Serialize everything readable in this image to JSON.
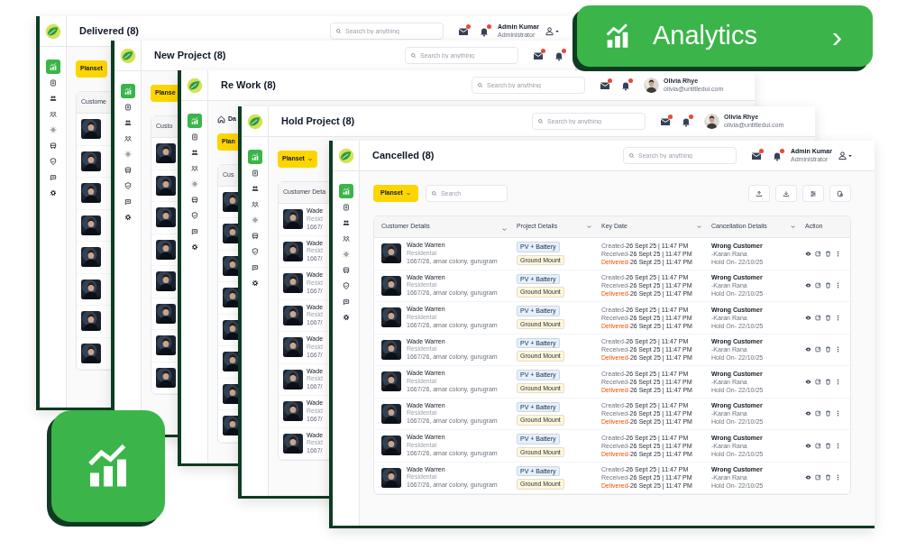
{
  "windows": [
    {
      "title": "Delivered (8)",
      "search": {
        "placeholder": "Search by anything"
      },
      "user": {
        "kind": "admin",
        "name": "Admin Kumar",
        "role": "Administrator"
      },
      "nav": [
        {
          "selected": true
        },
        {
          "selected": false
        },
        {
          "selected": false
        },
        {
          "selected": false
        },
        {
          "selected": false
        },
        {
          "selected": false
        },
        {
          "selected": false
        },
        {
          "selected": false
        },
        {
          "selected": false
        }
      ],
      "filter_button": {
        "label": "Planset",
        "caret": false
      },
      "table": {
        "header": "Custome"
      }
    },
    {
      "title": "New Project (8)",
      "search": {
        "placeholder": "Search by anything"
      },
      "nav": [
        {
          "selected": true
        },
        {
          "selected": false
        },
        {
          "selected": false
        },
        {
          "selected": false
        },
        {
          "selected": false
        },
        {
          "selected": false
        },
        {
          "selected": false
        },
        {
          "selected": false
        },
        {
          "selected": false
        }
      ],
      "filter_button": {
        "label": "Planse",
        "caret": false
      },
      "table": {
        "header": "Custo"
      }
    },
    {
      "title": "Re Work (8)",
      "search": {
        "placeholder": "Search by anything"
      },
      "user": {
        "kind": "avatar",
        "name": "Olivia Rhye",
        "email": "olivia@untitledui.com"
      },
      "nav": [
        {
          "selected": true
        },
        {
          "selected": false
        },
        {
          "selected": false
        },
        {
          "selected": false
        },
        {
          "selected": false
        },
        {
          "selected": false
        },
        {
          "selected": false
        },
        {
          "selected": false
        },
        {
          "selected": false
        }
      ],
      "breadcrumb": "Da",
      "filter_button": {
        "label": "Plan",
        "caret": false
      },
      "table": {
        "header": "Cus"
      }
    },
    {
      "title": "Hold Project (8)",
      "search": {
        "placeholder": "Search by anything"
      },
      "user": {
        "kind": "avatar",
        "name": "Olivia Rhye",
        "email": "olivia@untitledui.com"
      },
      "nav": [
        {
          "selected": true
        },
        {
          "selected": false
        },
        {
          "selected": false
        },
        {
          "selected": false
        },
        {
          "selected": false
        },
        {
          "selected": false
        },
        {
          "selected": false
        },
        {
          "selected": false
        },
        {
          "selected": false
        }
      ],
      "filter_button": {
        "label": "Planset",
        "caret": true
      },
      "table": {
        "header": "Customer Deta",
        "rows": [
          {
            "kind": "picture",
            "name": "Wade",
            "type": "Resid",
            "address": "1667/"
          },
          {
            "kind": "picture",
            "name": "Wade",
            "type": "Resid",
            "address": "1667/"
          },
          {
            "kind": "picture",
            "name": "Wade",
            "type": "Resid",
            "address": "1667/"
          },
          {
            "kind": "picture",
            "name": "Wade",
            "type": "Resid",
            "address": "1667/"
          },
          {
            "kind": "picture",
            "name": "Wade",
            "type": "Resid",
            "address": "1667/"
          },
          {
            "kind": "picture",
            "name": "Wade",
            "type": "Resid",
            "address": "1667/"
          },
          {
            "kind": "picture",
            "name": "Wade",
            "type": "Resid",
            "address": "1667/"
          },
          {
            "kind": "picture",
            "name": "Wade",
            "type": "Resid",
            "address": "1667/"
          }
        ]
      }
    },
    {
      "title": "Cancelled (8)",
      "search": {
        "placeholder": "Search by anything"
      },
      "user": {
        "kind": "admin",
        "name": "Admin Kumar",
        "role": "Administrator"
      },
      "nav": [
        {
          "selected": true
        },
        {
          "selected": false
        },
        {
          "selected": false
        },
        {
          "selected": false
        },
        {
          "selected": false
        },
        {
          "selected": false
        },
        {
          "selected": false
        },
        {
          "selected": false
        },
        {
          "selected": false
        }
      ],
      "filter_button": {
        "label": "Planset",
        "caret": true
      },
      "toolbar_search": {
        "placeholder": "Search"
      },
      "table": {
        "columns": [
          {
            "label": "Customer Details",
            "sortable": true
          },
          {
            "label": "Project Details",
            "sortable": true
          },
          {
            "label": "Key Date",
            "sortable": true
          },
          {
            "label": "Cancellation Details",
            "sortable": true
          },
          {
            "label": "Action",
            "sortable": false
          }
        ],
        "rows": [
          {
            "kind": "picture",
            "name": "Wade Warren",
            "type": "Residental",
            "address": "1667/26, amar colony, gurugram",
            "tags": [
              {
                "text": "PV + Battery",
                "color": "#e3f0ff"
              },
              {
                "text": "Ground Mount",
                "color": "#fff7dc"
              }
            ],
            "dates": [
              {
                "kind": "created",
                "label": "Created-",
                "value": "26 Sept 25 | 11:47 PM"
              },
              {
                "kind": "received",
                "label": "Received-",
                "value": "26 Sept 25 | 11:47 PM"
              },
              {
                "kind": "delivered",
                "label": "Delivered-",
                "value": "26 Sept 25 | 11:47 PM"
              }
            ],
            "reason": "Wrong Customer",
            "by": "-Karan Rana",
            "hold": "Hold On- 22/10/25"
          },
          {
            "kind": "picture",
            "name": "Wade Warren",
            "type": "Residental",
            "address": "1667/26, amar colony, gurugram",
            "tags": [
              {
                "text": "PV + Battery",
                "color": "#e3f0ff"
              },
              {
                "text": "Ground Mount",
                "color": "#fff7dc"
              }
            ],
            "dates": [
              {
                "kind": "created",
                "label": "Created-",
                "value": "26 Sept 25 | 11:47 PM"
              },
              {
                "kind": "received",
                "label": "Received-",
                "value": "26 Sept 25 | 11:47 PM"
              },
              {
                "kind": "delivered",
                "label": "Delivered-",
                "value": "26 Sept 25 | 11:47 PM"
              }
            ],
            "reason": "Wrong Customer",
            "by": "-Karan Rana",
            "hold": "Hold On- 22/10/25"
          },
          {
            "kind": "picture",
            "name": "Wade Warren",
            "type": "Residental",
            "address": "1667/26, amar colony, gurugram",
            "tags": [
              {
                "text": "PV + Battery",
                "color": "#e3f0ff"
              },
              {
                "text": "Ground Mount",
                "color": "#fff7dc"
              }
            ],
            "dates": [
              {
                "kind": "created",
                "label": "Created-",
                "value": "26 Sept 25 | 11:47 PM"
              },
              {
                "kind": "received",
                "label": "Received-",
                "value": "26 Sept 25 | 11:47 PM"
              },
              {
                "kind": "delivered",
                "label": "Delivered-",
                "value": "26 Sept 25 | 11:47 PM"
              }
            ],
            "reason": "Wrong Customer",
            "by": "-Karan Rana",
            "hold": "Hold On- 22/10/25"
          },
          {
            "kind": "picture",
            "name": "Wade Warren",
            "type": "Residental",
            "address": "1667/26, amar colony, gurugram",
            "tags": [
              {
                "text": "PV + Battery",
                "color": "#e3f0ff"
              },
              {
                "text": "Ground Mount",
                "color": "#fff7dc"
              }
            ],
            "dates": [
              {
                "kind": "created",
                "label": "Created-",
                "value": "26 Sept 25 | 11:47 PM"
              },
              {
                "kind": "received",
                "label": "Received-",
                "value": "26 Sept 25 | 11:47 PM"
              },
              {
                "kind": "delivered",
                "label": "Delivered-",
                "value": "26 Sept 25 | 11:47 PM"
              }
            ],
            "reason": "Wrong Customer",
            "by": "-Karan Rana",
            "hold": "Hold On- 22/10/25"
          },
          {
            "kind": "picture",
            "name": "Wade Warren",
            "type": "Residental",
            "address": "1667/26, amar colony, gurugram",
            "tags": [
              {
                "text": "PV + Battery",
                "color": "#e3f0ff"
              },
              {
                "text": "Ground Mount",
                "color": "#fff7dc"
              }
            ],
            "dates": [
              {
                "kind": "created",
                "label": "Created-",
                "value": "26 Sept 25 | 11:47 PM"
              },
              {
                "kind": "received",
                "label": "Received-",
                "value": "26 Sept 25 | 11:47 PM"
              },
              {
                "kind": "delivered",
                "label": "Delivered-",
                "value": "26 Sept 25 | 11:47 PM"
              }
            ],
            "reason": "Wrong Customer",
            "by": "-Karan Rana",
            "hold": "Hold On- 22/10/25"
          },
          {
            "kind": "picture",
            "name": "Wade Warren",
            "type": "Residental",
            "address": "1667/26, amar colony, gurugram",
            "tags": [
              {
                "text": "PV + Battery",
                "color": "#e3f0ff"
              },
              {
                "text": "Ground Mount",
                "color": "#fff7dc"
              }
            ],
            "dates": [
              {
                "kind": "created",
                "label": "Created-",
                "value": "26 Sept 25 | 11:47 PM"
              },
              {
                "kind": "received",
                "label": "Received-",
                "value": "26 Sept 25 | 11:47 PM"
              },
              {
                "kind": "delivered",
                "label": "Delivered-",
                "value": "26 Sept 25 | 11:47 PM"
              }
            ],
            "reason": "Wrong Customer",
            "by": "-Karan Rana",
            "hold": "Hold On- 22/10/25"
          },
          {
            "kind": "picture",
            "name": "Wade Warren",
            "type": "Residental",
            "address": "1667/26, amar colony, gurugram",
            "tags": [
              {
                "text": "PV + Battery",
                "color": "#e3f0ff"
              },
              {
                "text": "Ground Mount",
                "color": "#fff7dc"
              }
            ],
            "dates": [
              {
                "kind": "created",
                "label": "Created-",
                "value": "26 Sept 25 | 11:47 PM"
              },
              {
                "kind": "received",
                "label": "Received-",
                "value": "26 Sept 25 | 11:47 PM"
              },
              {
                "kind": "delivered",
                "label": "Delivered-",
                "value": "26 Sept 25 | 11:47 PM"
              }
            ],
            "reason": "Wrong Customer",
            "by": "-Karan Rana",
            "hold": "Hold On- 22/10/25"
          },
          {
            "kind": "picture",
            "name": "Wade Warren",
            "type": "Residental",
            "address": "1667/26, amar colony, gurugram",
            "tags": [
              {
                "text": "PV + Battery",
                "color": "#e3f0ff"
              },
              {
                "text": "Ground Mount",
                "color": "#fff7dc"
              }
            ],
            "dates": [
              {
                "kind": "created",
                "label": "Created-",
                "value": "26 Sept 25 | 11:47 PM"
              },
              {
                "kind": "received",
                "label": "Received-",
                "value": "26 Sept 25 | 11:47 PM"
              },
              {
                "kind": "delivered",
                "label": "Delivered-",
                "value": "26 Sept 25 | 11:47 PM"
              }
            ],
            "reason": "Wrong Customer",
            "by": "-Karan Rana",
            "hold": "Hold On- 22/10/25"
          }
        ]
      }
    }
  ],
  "analytics_badge": {
    "label": "Analytics",
    "arrow": "›"
  }
}
